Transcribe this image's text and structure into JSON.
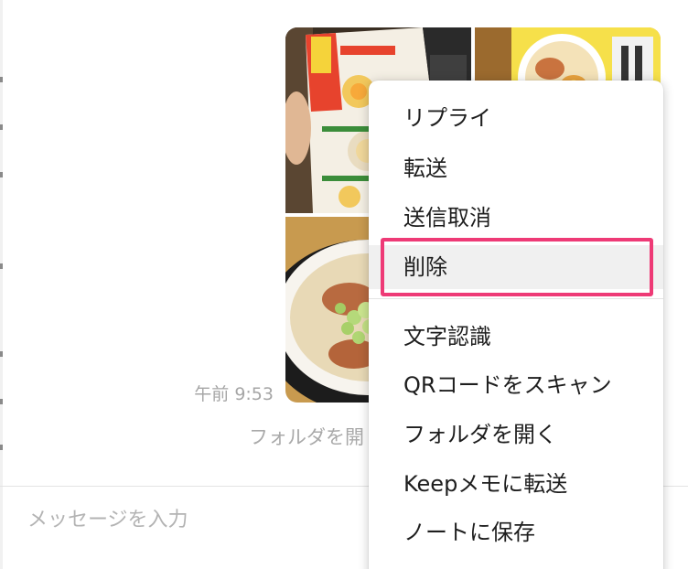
{
  "chat": {
    "timestamp": "午前 9:53",
    "folder_link_label": "フォルダを開"
  },
  "input": {
    "placeholder": "メッセージを入力"
  },
  "context_menu": {
    "items": [
      {
        "label": "リプライ"
      },
      {
        "label": "転送"
      },
      {
        "label": "送信取消"
      },
      {
        "label": "削除",
        "highlighted": true
      },
      {
        "label": "文字認識"
      },
      {
        "label": "QRコードをスキャン"
      },
      {
        "label": "フォルダを開く"
      },
      {
        "label": "Keepメモに転送"
      },
      {
        "label": "ノートに保存"
      }
    ]
  },
  "colors": {
    "highlight_border": "#ee3a76",
    "menu_text": "#1e1e1e",
    "muted_text": "#a6a6a6"
  }
}
